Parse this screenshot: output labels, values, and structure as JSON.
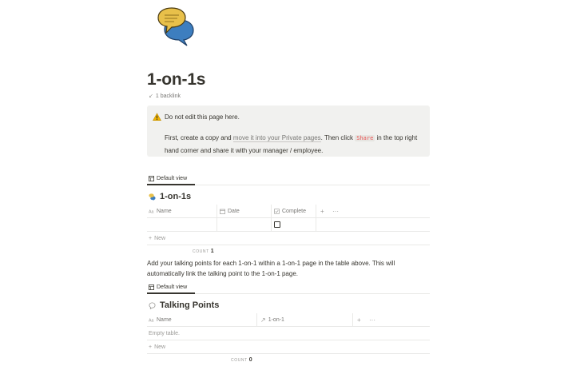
{
  "page": {
    "title": "1-on-1s",
    "backlink": "1 backlink",
    "icon": "speech-bubbles-icon"
  },
  "callout": {
    "icon": "warning-icon",
    "line1": "Do not edit this page here.",
    "para_pre": "First, create a copy and ",
    "para_link": "move it into your Private pages",
    "para_mid": ". Then click ",
    "para_code": "Share",
    "para_post": " in the top right hand corner and share it with your manager / employee."
  },
  "db1": {
    "view_tab": "Default view",
    "title": "1-on-1s",
    "columns": [
      {
        "label": "Name",
        "icon": "text-icon"
      },
      {
        "label": "Date",
        "icon": "calendar-icon"
      },
      {
        "label": "Complete",
        "icon": "checkbox-icon"
      }
    ],
    "rows": [
      {
        "name": "",
        "date": "",
        "complete": false
      }
    ],
    "new_label": "New",
    "count_label": "COUNT",
    "count_value": "1"
  },
  "body_text": "Add your talking points for each 1-on-1 within a 1-on-1 page in the table above. This will automatically link the talking point to the 1-on-1 page.",
  "db2": {
    "view_tab": "Default view",
    "title": "Talking Points",
    "columns": [
      {
        "label": "Name",
        "icon": "text-icon"
      },
      {
        "label": "1-on-1",
        "icon": "relation-arrow-icon"
      }
    ],
    "empty_label": "Empty table.",
    "new_label": "New",
    "count_label": "COUNT",
    "count_value": "0"
  },
  "colors": {
    "text": "#37352f",
    "muted": "#787774",
    "callout_bg": "#f1f1ef",
    "code_text": "#eb5757",
    "icon_yellow": "#e8c04a",
    "icon_blue": "#3d7ebf"
  }
}
